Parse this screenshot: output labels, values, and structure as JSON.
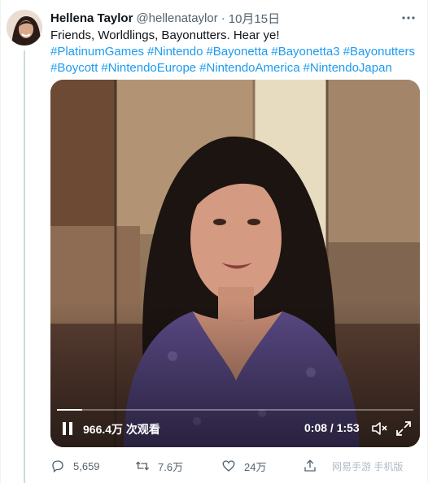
{
  "tweet": {
    "author_name": "Hellena Taylor",
    "author_handle": "@hellenataylor",
    "separator": "·",
    "timestamp": "10月15日",
    "more_icon": "more-horizontal-icon",
    "text_line": "Friends, Worldlings, Bayonutters. Hear ye!",
    "hashtags_line1": [
      "#PlatinumGames",
      "#Nintendo",
      "#Bayonetta",
      "#Bayonetta3",
      "#Bayonutters"
    ],
    "hashtags_line2": [
      "#Boycott",
      "#NintendoEurope",
      "#NintendoAmerica",
      "#NintendoJapan"
    ],
    "hashtag_color": "#1d9bf0"
  },
  "video": {
    "view_count": "966.4万 次观看",
    "current_time": "0:08",
    "duration": "1:53",
    "time_display": "0:08 / 1:53",
    "progress_fraction": 0.07,
    "play_state_icon": "pause-icon",
    "volume_icon": "volume-muted-icon",
    "fullscreen_icon": "fullscreen-icon"
  },
  "actions": {
    "reply_count": "5,659",
    "retweet_count": "7.6万",
    "like_count": "24万",
    "reply_icon": "reply-icon",
    "retweet_icon": "retweet-icon",
    "like_icon": "heart-icon",
    "share_icon": "share-icon"
  },
  "watermark": "网易手游 手机版"
}
